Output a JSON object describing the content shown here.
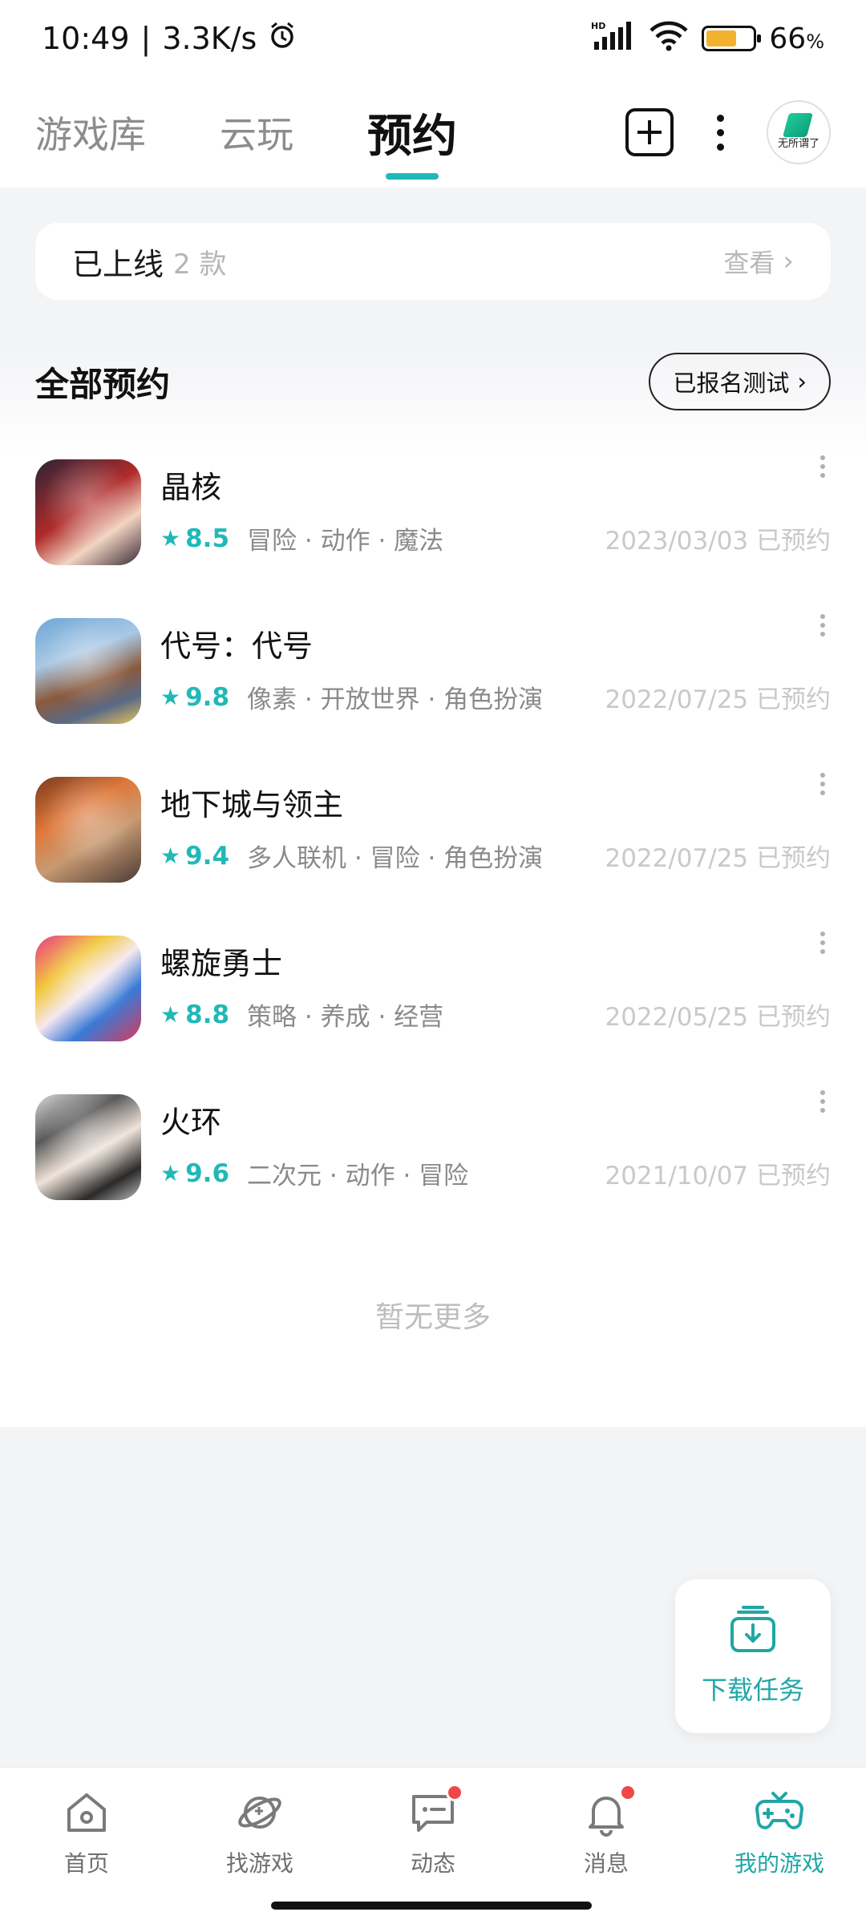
{
  "status_bar": {
    "time": "10:49",
    "net_speed": "3.3K/s",
    "battery_percent": "66",
    "battery_unit": "%",
    "battery_level": 0.66,
    "icons": [
      "alarm-icon",
      "hd-signal-icon",
      "wifi-icon",
      "battery-icon"
    ]
  },
  "header": {
    "tabs": [
      {
        "label": "游戏库",
        "active": false
      },
      {
        "label": "云玩",
        "active": false
      },
      {
        "label": "预约",
        "active": true
      }
    ],
    "avatar_text": "无所谓了",
    "accent_color": "#21b8b8"
  },
  "online": {
    "title": "已上线",
    "count": "2 款",
    "view": "查看"
  },
  "section": {
    "title": "全部预约",
    "test_button": "已报名测试"
  },
  "games": [
    {
      "name": "晶核",
      "score": "8.5",
      "tags": "冒险 · 动作 · 魔法",
      "date": "2023/03/03 已预约"
    },
    {
      "name": "代号：代号",
      "score": "9.8",
      "tags": "像素 · 开放世界 · 角色扮演",
      "date": "2022/07/25 已预约"
    },
    {
      "name": "地下城与领主",
      "score": "9.4",
      "tags": "多人联机 · 冒险 · 角色扮演",
      "date": "2022/07/25 已预约"
    },
    {
      "name": "螺旋勇士",
      "score": "8.8",
      "tags": "策略 · 养成 · 经营",
      "date": "2022/05/25 已预约"
    },
    {
      "name": "火环",
      "score": "9.6",
      "tags": "二次元 · 动作 · 冒险",
      "date": "2021/10/07 已预约"
    }
  ],
  "no_more": "暂无更多",
  "download_fab": {
    "label": "下载任务"
  },
  "bottom_nav": [
    {
      "label": "首页",
      "icon": "home-icon",
      "badge": false,
      "active": false
    },
    {
      "label": "找游戏",
      "icon": "planet-icon",
      "badge": false,
      "active": false
    },
    {
      "label": "动态",
      "icon": "chat-icon",
      "badge": true,
      "active": false
    },
    {
      "label": "消息",
      "icon": "bell-icon",
      "badge": true,
      "active": false
    },
    {
      "label": "我的游戏",
      "icon": "gamepad-icon",
      "badge": false,
      "active": true
    }
  ]
}
